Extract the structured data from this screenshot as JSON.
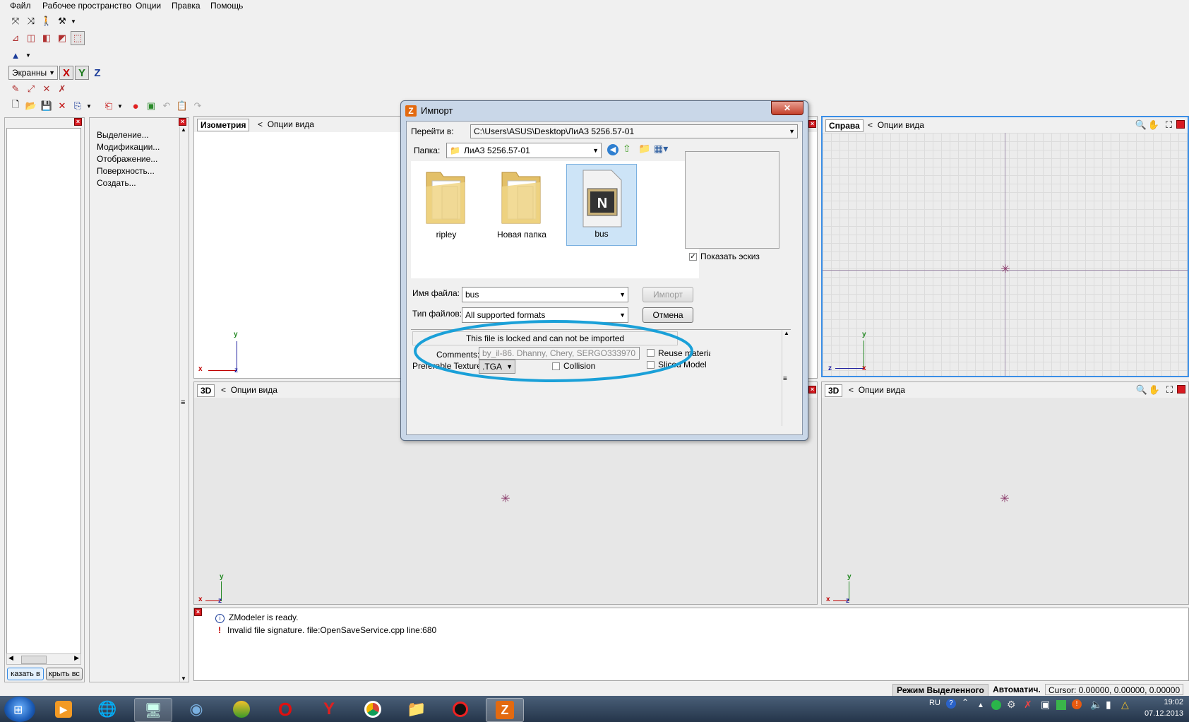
{
  "menu": [
    "Файл",
    "Рабочее пространство",
    "Опции",
    "Правка",
    "Помощь"
  ],
  "toolbar": {
    "coord_mode": "Экранны",
    "axis_x": "X",
    "axis_y": "Y",
    "axis_z": "Z"
  },
  "left_panel": {
    "buttons": [
      "казать в",
      "крыть вс"
    ]
  },
  "command_panel": {
    "items": [
      "Выделение...",
      "Модификации...",
      "Отображение...",
      "Поверхность...",
      "Создать..."
    ]
  },
  "viewports": {
    "top_left": {
      "name": "Изометрия",
      "options": "Опции вида"
    },
    "top_right": {
      "name": "Справа",
      "options": "Опции вида"
    },
    "bottom_left": {
      "name": "3D",
      "options": "Опции вида"
    },
    "bottom_right": {
      "name": "3D",
      "options": "Опции вида"
    },
    "axis_labels": {
      "x": "x",
      "y": "y",
      "z": "z"
    }
  },
  "dialog": {
    "title": "Импорт",
    "goto_label": "Перейти в:",
    "goto_path": "C:\\Users\\ASUS\\Desktop\\ЛиАЗ 5256.57-01",
    "folder_label": "Папка:",
    "folder_value": "ЛиАЗ 5256.57-01",
    "files": [
      "ripley",
      "Новая папка",
      "bus"
    ],
    "preview_checkbox": "Показать эскиз",
    "filename_label": "Имя файла:",
    "filename_value": "bus",
    "filetype_label": "Тип файлов:",
    "filetype_value": "All supported formats",
    "import_button": "Импорт",
    "cancel_button": "Отмена",
    "locked_message": "This file is locked and can not be imported",
    "comments_label": "Comments:",
    "comments_value": "by_il-86. Dhanny, Chery, SERGO333970",
    "reuse_materials": "Reuse materials",
    "preferable_textures_label": "Preferable Textures:",
    "preferable_textures_value": ".TGA",
    "collision": "Collision",
    "sliced_model": "Sliced Model"
  },
  "log": [
    {
      "icon": "info",
      "text": "ZModeler is ready."
    },
    {
      "icon": "error",
      "text": "Invalid file signature. file:OpenSaveService.cpp line:680"
    }
  ],
  "statusbar": {
    "mode": "Режим Выделенного",
    "auto": "Автоматич.",
    "cursor": "Cursor: 0.00000, 0.00000, 0.00000"
  },
  "taskbar": {
    "lang": "RU",
    "time": "19:02",
    "date": "07.12.2013"
  },
  "colors": {
    "highlight_ellipse": "#1aa0d8",
    "active_viewport_border": "#3a8ee6",
    "close_red": "#d71a21"
  }
}
